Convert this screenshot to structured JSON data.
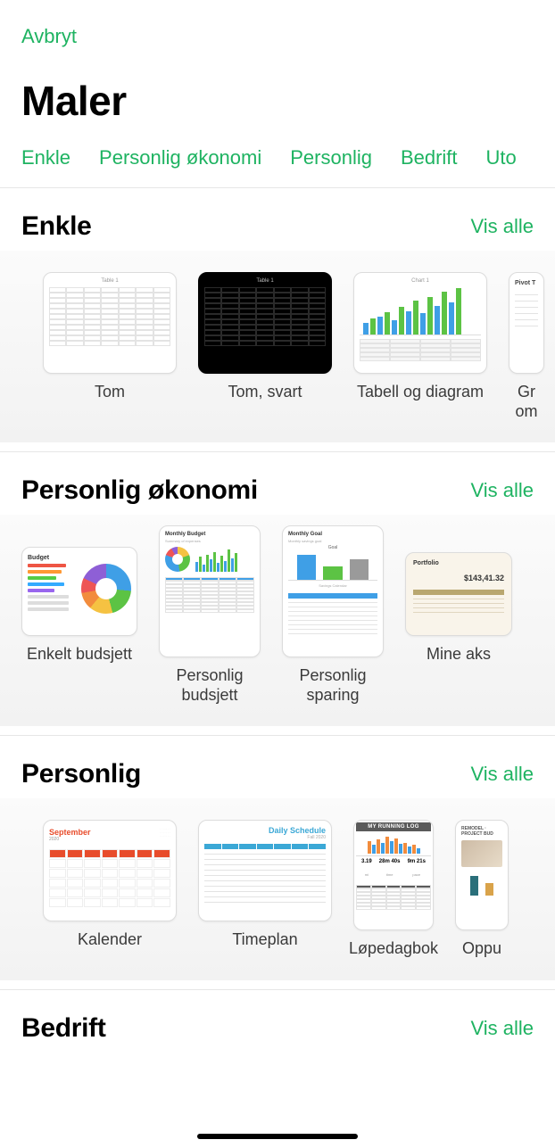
{
  "header": {
    "cancel": "Avbryt",
    "title": "Maler"
  },
  "tabs": [
    "Enkle",
    "Personlig økonomi",
    "Personlig",
    "Bedrift",
    "Uto"
  ],
  "view_all_label": "Vis alle",
  "sections": [
    {
      "title": "Enkle",
      "items": [
        {
          "label": "Tom"
        },
        {
          "label": "Tom, svart"
        },
        {
          "label": "Tabell og diagram"
        },
        {
          "label": "Gr om"
        }
      ]
    },
    {
      "title": "Personlig økonomi",
      "items": [
        {
          "label": "Enkelt budsjett"
        },
        {
          "label": "Personlig budsjett"
        },
        {
          "label": "Personlig sparing"
        },
        {
          "label": "Mine aks"
        }
      ]
    },
    {
      "title": "Personlig",
      "items": [
        {
          "label": "Kalender"
        },
        {
          "label": "Timeplan"
        },
        {
          "label": "Løpedagbok"
        },
        {
          "label": "Oppu"
        }
      ]
    },
    {
      "title": "Bedrift",
      "items": []
    }
  ],
  "thumbs": {
    "tom_title": "Table 1",
    "chart_title": "Chart 1",
    "monthly_budget_title": "Monthly Budget",
    "monthly_goal_title": "Monthly Goal",
    "budget_title": "Budget",
    "portfolio_title": "Portfolio",
    "portfolio_value": "$143,41.32",
    "calendar_month": "September",
    "calendar_year": "2020",
    "daily_schedule_title": "Daily Schedule",
    "daily_schedule_sub": "Fall 2020",
    "running_log_title": "MY RUNNING LOG",
    "running_stats": [
      {
        "v": "3.19",
        "l": "mi"
      },
      {
        "v": "28m 40s",
        "l": "time"
      },
      {
        "v": "9m 21s",
        "l": "pace"
      }
    ],
    "remodel_title": "REMODEL · PROJECT BUD",
    "pivot_title": "Pivot T"
  }
}
